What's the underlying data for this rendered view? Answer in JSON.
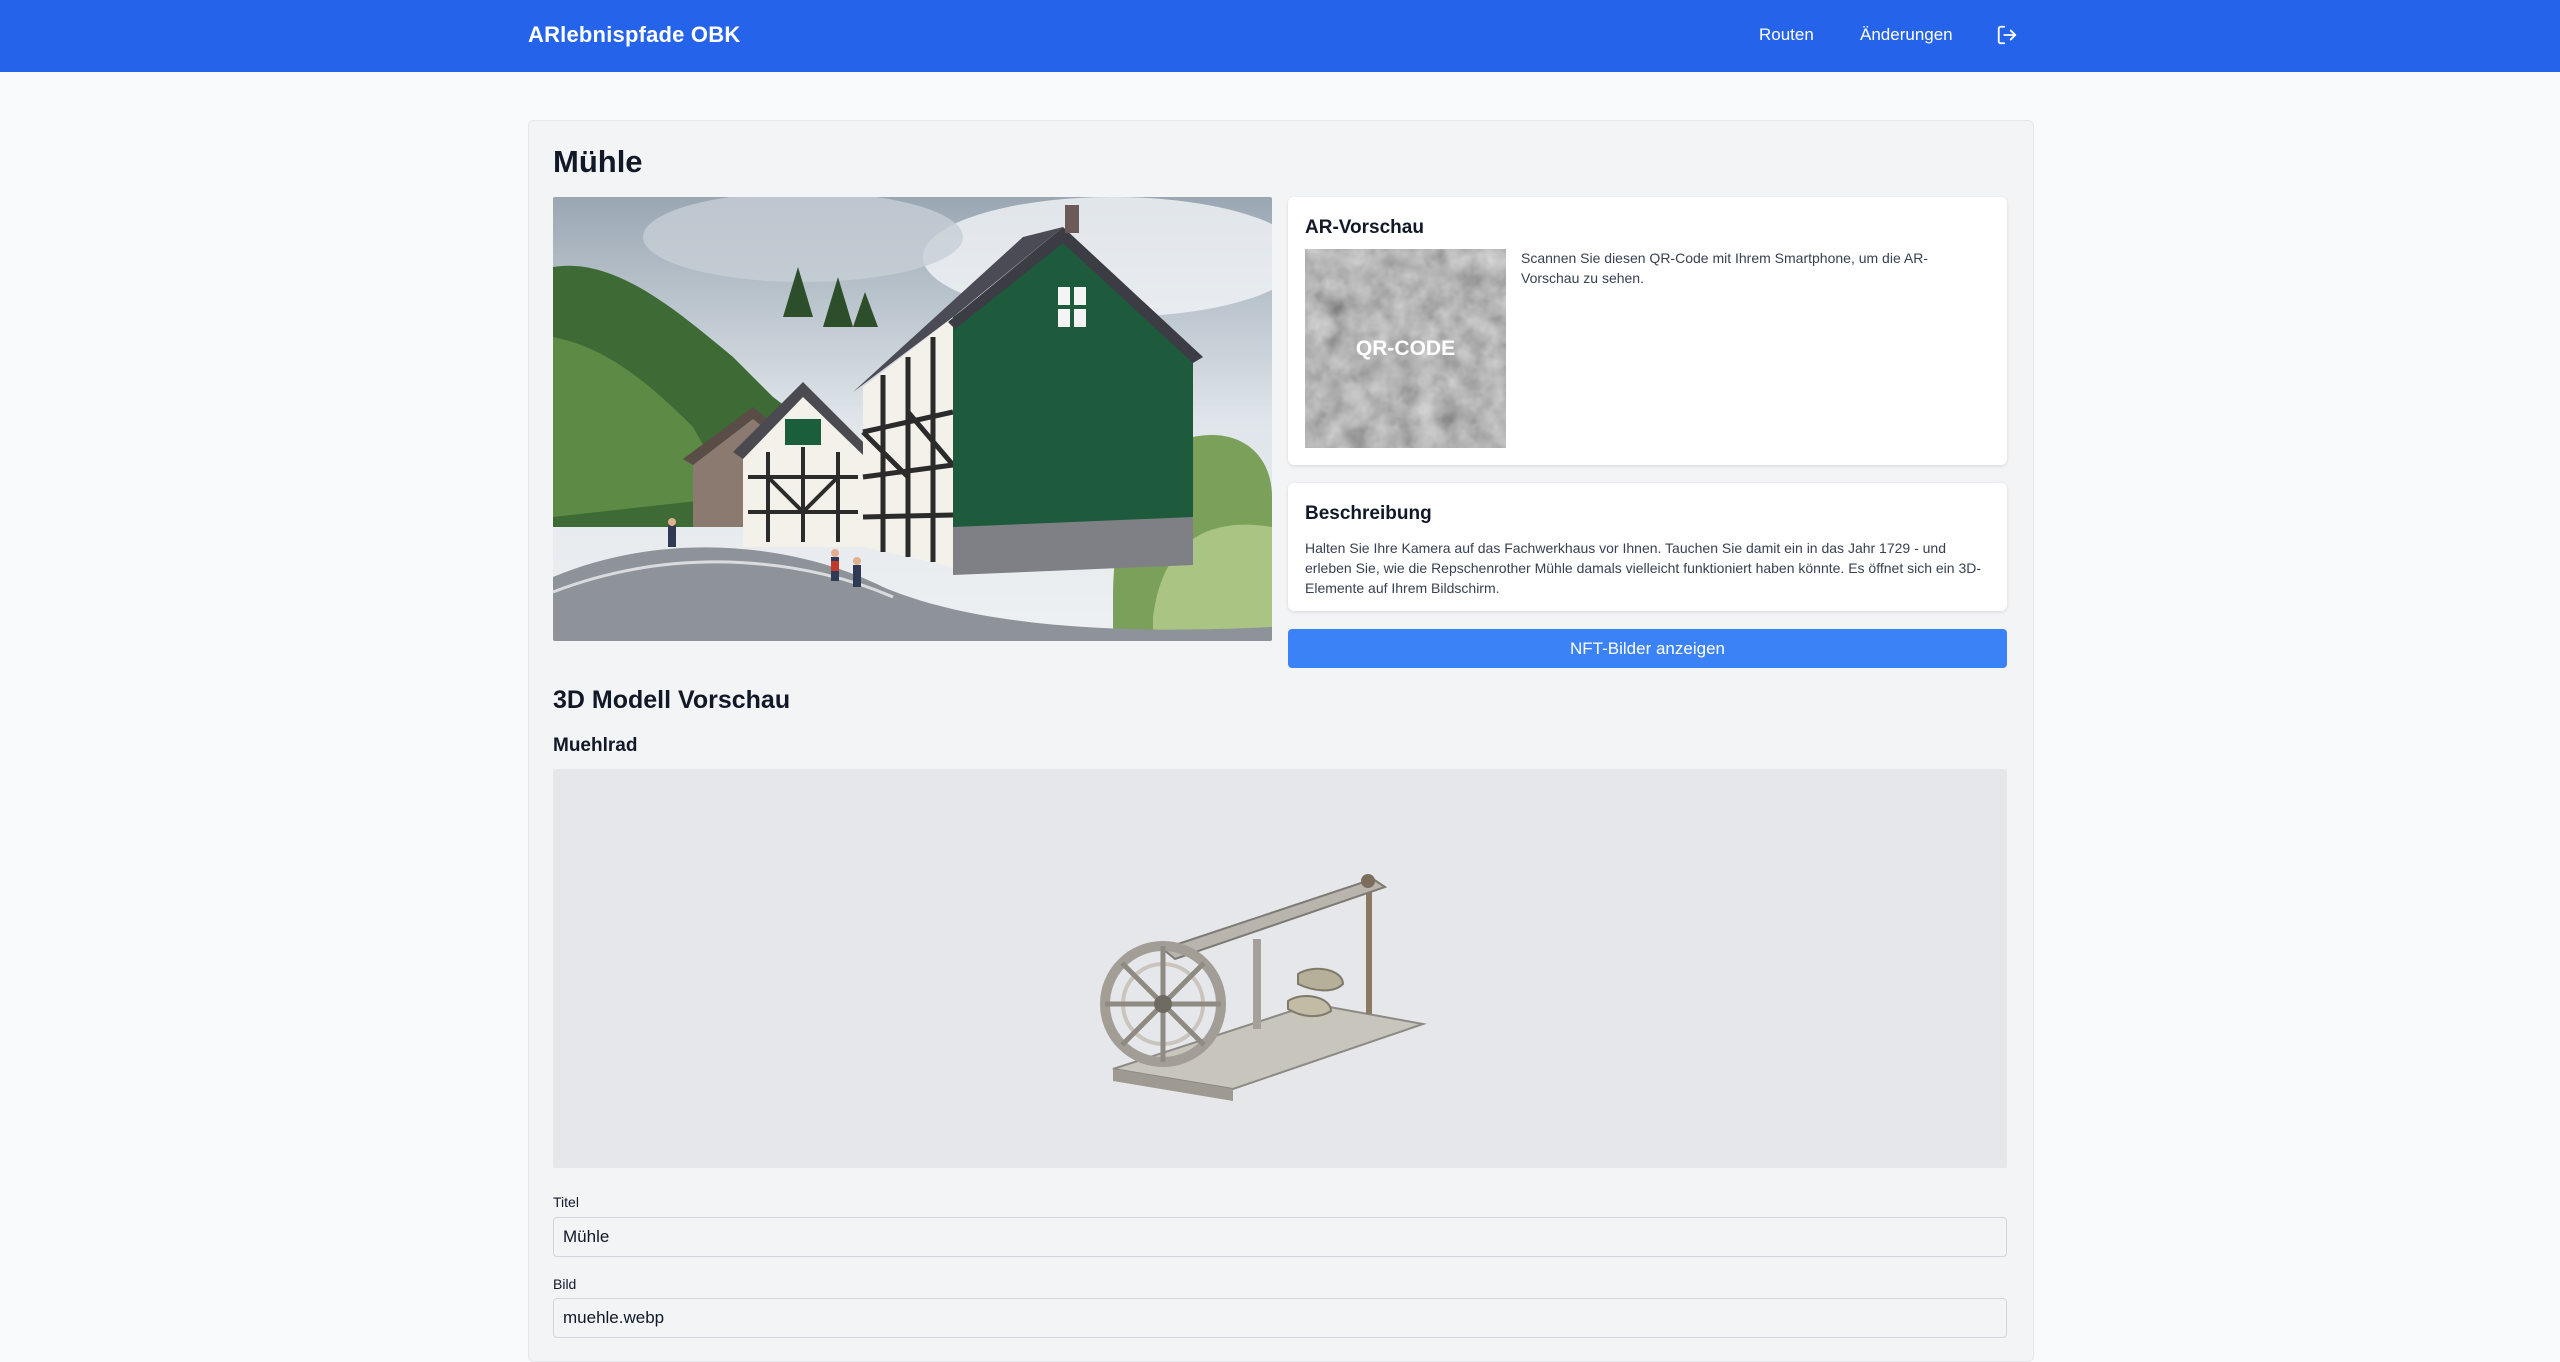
{
  "header": {
    "brand": "ARlebnispfade OBK",
    "nav": {
      "routes": "Routen",
      "changes": "Änderungen"
    }
  },
  "page": {
    "title": "Mühle"
  },
  "ar_preview": {
    "heading": "AR-Vorschau",
    "qr_label": "QR-CODE",
    "hint": "Scannen Sie diesen QR-Code mit Ihrem Smartphone, um die AR-Vorschau zu sehen."
  },
  "description": {
    "heading": "Beschreibung",
    "text": "Halten Sie Ihre Kamera auf das Fachwerkhaus vor Ihnen. Tauchen Sie damit ein in das Jahr 1729 - und erleben Sie, wie die Repschenrother Mühle damals vielleicht funktioniert haben könnte. Es öffnet sich ein 3D-Elemente auf Ihrem Bildschirm."
  },
  "nft_button": "NFT-Bilder anzeigen",
  "model_section": {
    "title": "3D Modell Vorschau",
    "model_name": "Muehlrad"
  },
  "form": {
    "title_label": "Titel",
    "title_value": "Mühle",
    "image_label": "Bild",
    "image_value": "muehle.webp"
  },
  "colors": {
    "header_bg": "#2563eb",
    "button_bg": "#3b82f6",
    "page_bg": "#f8fafc"
  },
  "icons": {
    "logout": "logout-icon"
  }
}
